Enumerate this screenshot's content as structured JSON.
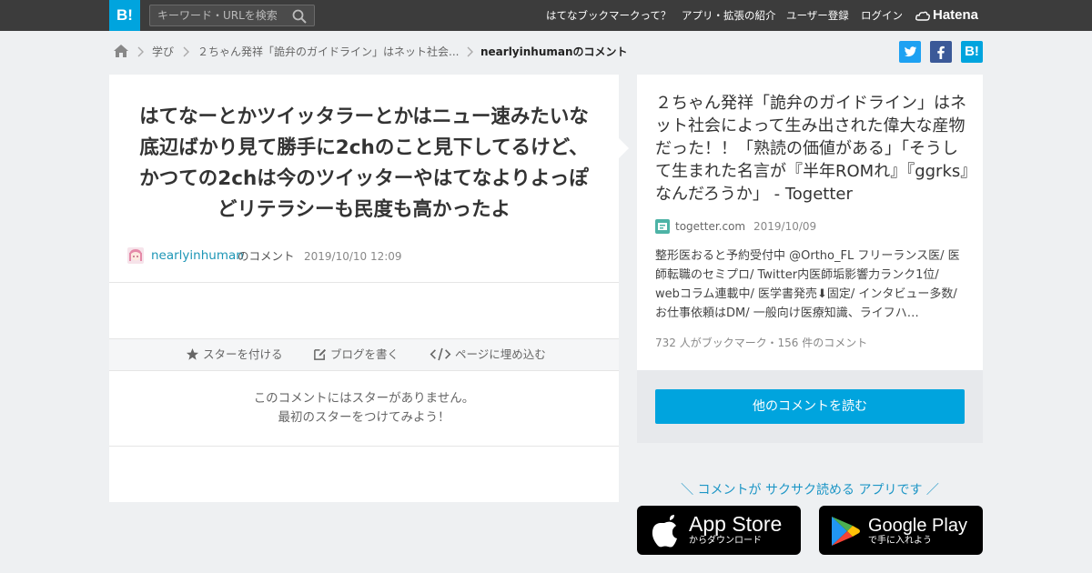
{
  "topbar": {
    "logo": "B!",
    "search_placeholder": "キーワード・URLを検索",
    "nav": [
      "はてなブックマークって？",
      "アプリ・拡張の紹介",
      "ユーザー登録",
      "ログイン"
    ],
    "brand": "Hatena"
  },
  "breadcrumb": {
    "items": [
      "学び",
      "２ちゃん発祥「詭弁のガイドライン」はネット社会...",
      "nearlyinhumanのコメント"
    ]
  },
  "comment": {
    "text": "はてなーとかツイッタラーとかはニュー速みたいな底辺ばかり見て勝手に2chのこと見下してるけど、かつての2chは今のツイッターやはてなよりよっぽどリテラシーも民度も高かったよ",
    "user": "nearlyinhuman",
    "user_suffix": "のコメント",
    "date": "2019/10/10 12:09",
    "actions": [
      "スターを付ける",
      "ブログを書く",
      "ページに埋め込む"
    ],
    "no_star_line1": "このコメントにはスターがありません。",
    "no_star_line2": "最初のスターをつけてみよう！"
  },
  "entry": {
    "title": "２ちゃん発祥「詭弁のガイドライン」はネット社会によって生み出された偉大な産物だった！！「熟読の価値がある」「そうして生まれた名言が『半年ROMれ』『ggrks』なんだろうか」 - Togetter",
    "domain": "togetter.com",
    "date": "2019/10/09",
    "summary": "整形医おると予約受付中 @Ortho_FL フリーランス医/ 医師転職のセミプロ/ Twitter内医師垢影響力ランク1位/ webコラム連載中/ 医学書発売⬇︎固定/ インタビュー多数/ お仕事依頼はDM/ 一般向け医療知識、ライフハ…",
    "stats": "732 人がブックマーク・156 件のコメント",
    "more_button": "他のコメントを読む"
  },
  "promo": {
    "text": "＼ コメントが サクサク読める アプリです ／",
    "app_store": {
      "big": "App Store",
      "small": "からダウンロード"
    },
    "google_play": {
      "big": "Google Play",
      "small": "で手に入れよう"
    }
  },
  "colors": {
    "topbar": "#3c3c3c",
    "brand_blue": "#00a4de",
    "link": "#1d96b6",
    "twitter": "#1da1f2",
    "facebook": "#3b5998"
  }
}
